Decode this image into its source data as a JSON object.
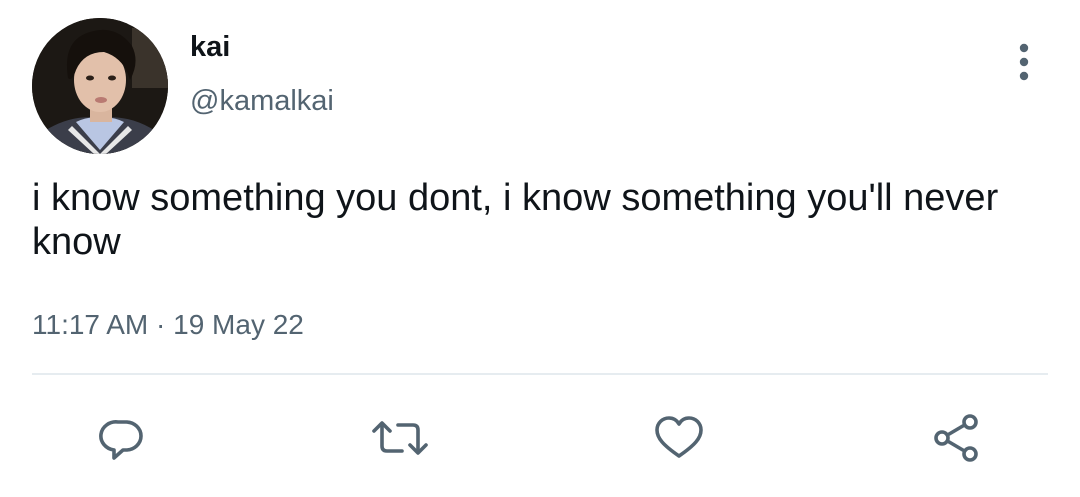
{
  "tweet": {
    "author": {
      "display_name": "kai",
      "handle": "@kamalkai"
    },
    "text": "i know something you dont, i know something you'll never know",
    "time": "11:17 AM",
    "separator": "·",
    "date": "19 May 22"
  },
  "actions": [
    {
      "icon": "reply-icon"
    },
    {
      "icon": "retweet-icon"
    },
    {
      "icon": "like-icon"
    },
    {
      "icon": "share-icon"
    }
  ],
  "menu": {
    "icon": "more-vertical-icon"
  },
  "colors": {
    "text_primary": "#0f1419",
    "text_secondary": "#536471",
    "icon": "#536471",
    "divider": "#e6ecf0"
  }
}
